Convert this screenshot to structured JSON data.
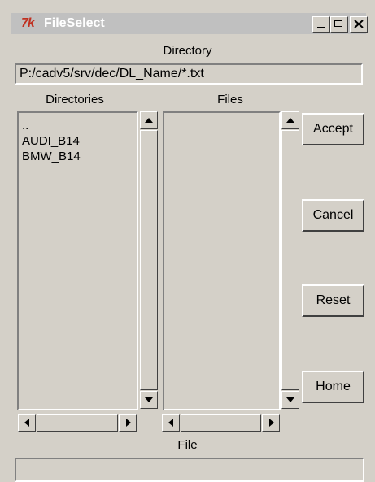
{
  "window": {
    "logo": "7k",
    "title": "FileSelect"
  },
  "directory": {
    "label": "Directory",
    "path": "P:/cadv5/srv/dec/DL_Name/*.txt"
  },
  "directories": {
    "label": "Directories",
    "items": [
      "..",
      "AUDI_B14",
      "BMW_B14"
    ]
  },
  "files": {
    "label": "Files",
    "items": []
  },
  "buttons": {
    "accept": "Accept",
    "cancel": "Cancel",
    "reset": "Reset",
    "home": "Home"
  },
  "file": {
    "label": "File",
    "value": ""
  },
  "icons": {
    "minimize": "minimize-icon",
    "maximize": "maximize-icon",
    "close": "close-icon"
  }
}
